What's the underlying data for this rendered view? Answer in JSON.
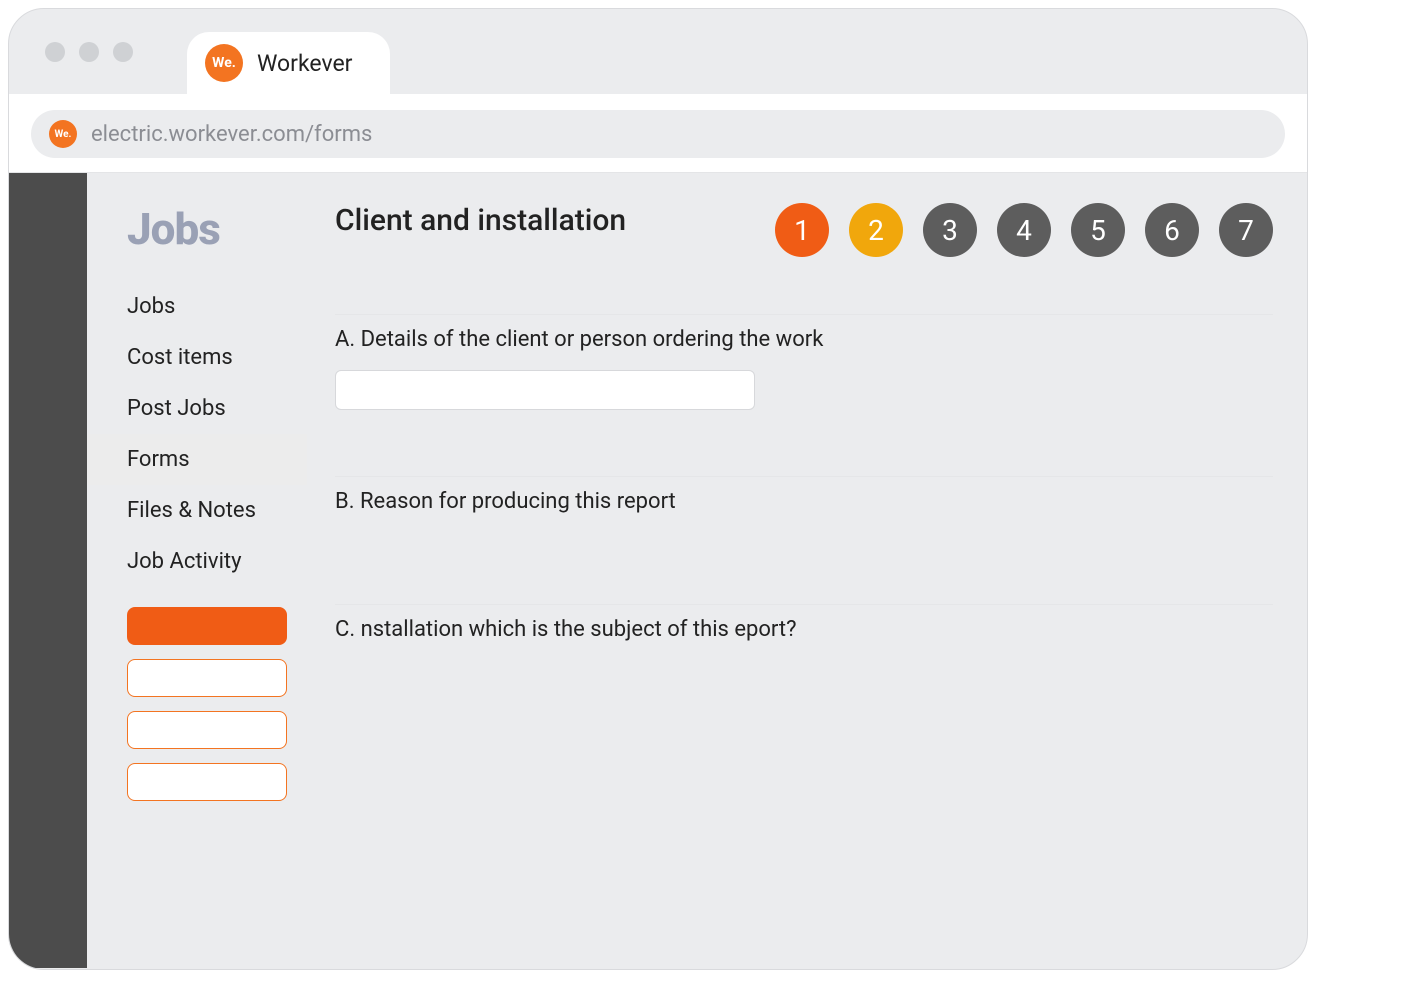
{
  "browser": {
    "tab_title": "Workever",
    "url": "electric.workever.com/forms",
    "favicon_text": "We."
  },
  "sidebar": {
    "heading": "Jobs",
    "items": [
      {
        "label": "Jobs",
        "active": false
      },
      {
        "label": "Cost items",
        "active": false
      },
      {
        "label": "Post Jobs",
        "active": false
      },
      {
        "label": "Forms",
        "active": true
      },
      {
        "label": "Files & Notes",
        "active": false
      },
      {
        "label": "Job Activity",
        "active": false
      }
    ]
  },
  "form": {
    "title": "Client and installation",
    "steps": [
      "1",
      "2",
      "3",
      "4",
      "5",
      "6",
      "7"
    ],
    "current_step": 1,
    "next_step": 2,
    "sections": {
      "a": "A. Details of the client or person ordering the work",
      "b": "B. Reason for producing this report",
      "c": "C. nstallation which is the subject of this eport?"
    },
    "client_input_value": ""
  }
}
